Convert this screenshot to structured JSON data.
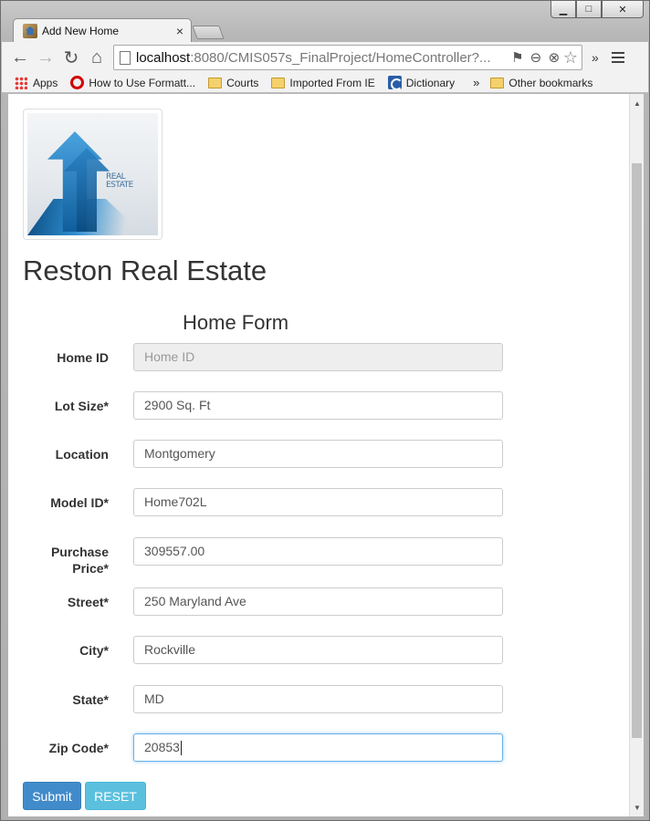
{
  "browser": {
    "tab_title": "Add New Home",
    "tab_close": "×",
    "url_host": "localhost",
    "url_rest": ":8080/CMIS057s_FinalProject/HomeController?...",
    "window_controls": {
      "minimize": "▁",
      "maximize": "□",
      "close": "✕"
    }
  },
  "toolbar": {
    "back": "←",
    "forward": "→",
    "reload": "↻",
    "home": "⌂",
    "star": "☆",
    "overflow": "»"
  },
  "bookmarks": {
    "items": [
      {
        "label": "Apps",
        "icon": "apps-icon"
      },
      {
        "label": "How to Use Formatt...",
        "icon": "opera-icon"
      },
      {
        "label": "Courts",
        "icon": "folder-icon"
      },
      {
        "label": "Imported From IE",
        "icon": "folder-icon"
      },
      {
        "label": "Dictionary",
        "icon": "dictionary-icon"
      }
    ],
    "more": "»",
    "other": "Other bookmarks"
  },
  "page": {
    "site_title": "Reston Real Estate",
    "logo_text_line1": "REAL",
    "logo_text_line2": "ESTATE",
    "form_title": "Home Form",
    "fields": [
      {
        "label": "Home ID",
        "label_line2": "",
        "value": "",
        "placeholder": "Home ID"
      },
      {
        "label": "Lot Size*",
        "label_line2": "",
        "value": "2900 Sq. Ft",
        "placeholder": ""
      },
      {
        "label": "Location",
        "label_line2": "",
        "value": "Montgomery",
        "placeholder": ""
      },
      {
        "label": "Model ID*",
        "label_line2": "",
        "value": "Home702L",
        "placeholder": ""
      },
      {
        "label": "Purchase",
        "label_line2": "Price*",
        "value": "309557.00",
        "placeholder": ""
      },
      {
        "label": "Street*",
        "label_line2": "",
        "value": "250 Maryland Ave",
        "placeholder": ""
      },
      {
        "label": "City*",
        "label_line2": "",
        "value": "Rockville",
        "placeholder": ""
      },
      {
        "label": "State*",
        "label_line2": "",
        "value": "MD",
        "placeholder": ""
      },
      {
        "label": "Zip Code*",
        "label_line2": "",
        "value": "20853",
        "placeholder": ""
      }
    ],
    "submit_label": "Submit",
    "reset_label": "RESET"
  },
  "colors": {
    "submit": "#428bca",
    "reset": "#5bc0de",
    "focus_border": "#66afe9"
  }
}
